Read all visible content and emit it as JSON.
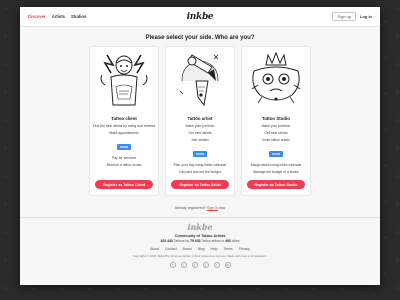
{
  "nav": {
    "items": [
      "Discover",
      "Artists",
      "Studios"
    ]
  },
  "brand": {
    "logo": "inkbe"
  },
  "auth": {
    "signup": "Sign up",
    "login": "Log in"
  },
  "headline": "Please select your side. Who are you?",
  "cards": [
    {
      "title": "Tattoo client",
      "features": [
        "Find the best artists by rating and reviews",
        "Make appointments"
      ],
      "soon": "SOON",
      "features2": [
        "Pay for services",
        "Become a tattoo model"
      ],
      "button": "Register as Tattoo Client"
    },
    {
      "title": "Tattoo artist",
      "features": [
        "Make your portfolio",
        "Get new clients",
        "Join studios"
      ],
      "soon": "SOON",
      "features2": [
        "Plan your day using inkbe calendar",
        "Get paid and set the budget"
      ],
      "button": "Register as Tattoo Artist"
    },
    {
      "title": "Tattoo Studio",
      "features": [
        "Make your portfolio",
        "Get new clients",
        "Invite tattoo artists"
      ],
      "soon": "SOON",
      "features2": [
        "Assign tasks using inkbe calendar",
        "Manage the budget of a studio"
      ],
      "button": "Register as Tattoo Studio"
    }
  ],
  "already": {
    "text": "Already registered?",
    "link": "Sign in",
    "suffix": "now"
  },
  "footer": {
    "logo": "inkbe",
    "community": "Community of Tattoo Artists",
    "stats_a": "433 443",
    "stats_a_label": "Tattoos by",
    "stats_b": "75 433",
    "stats_b_label": "Tattoo artists in",
    "stats_c": "493",
    "stats_c_label": "cities",
    "links": [
      "About",
      "Contact",
      "Brand",
      "Blog",
      "Help",
      "Terms",
      "Privacy"
    ],
    "copyright": "Copyright © 2015 Inkbe BV. All screenshots © their respective owners. Made with love in Amsterdam.",
    "social_icons": [
      "facebook-icon",
      "twitter-icon",
      "vimeo-icon",
      "google-plus-icon",
      "tumblr-icon",
      "vk-icon"
    ],
    "social_glyphs": [
      "f",
      "t",
      "v",
      "g",
      "t",
      "vk"
    ]
  },
  "colors": {
    "accent": "#f13c54",
    "soon": "#3a8cf0",
    "active_nav": "#e8434b"
  }
}
